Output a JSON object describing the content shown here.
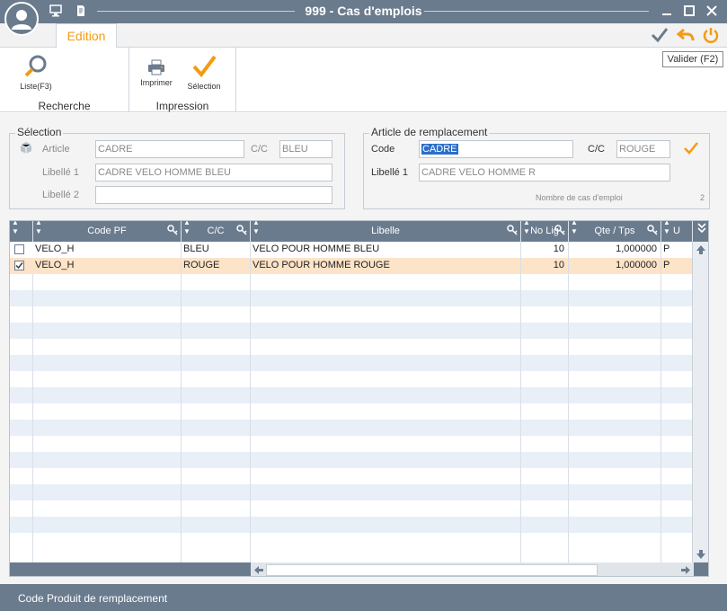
{
  "window": {
    "title": "999 - Cas d'emplois"
  },
  "header": {
    "tooltip": "Valider (F2)"
  },
  "ribbon": {
    "tab_label": "Edition",
    "groups": [
      {
        "label": "Recherche",
        "buttons": [
          {
            "label": "Liste(F3)",
            "icon": "magnifier-icon"
          }
        ]
      },
      {
        "label": "Impression",
        "buttons": [
          {
            "label": "Imprimer",
            "icon": "printer-icon"
          },
          {
            "label": "Sélection",
            "icon": "checkmark-icon"
          }
        ]
      }
    ]
  },
  "selection": {
    "title": "Sélection",
    "article_label": "Article",
    "article_value": "CADRE",
    "cc_label": "C/C",
    "cc_value": "BLEU",
    "libelle1_label": "Libellé 1",
    "libelle1_value": "CADRE VELO HOMME BLEU",
    "libelle2_label": "Libellé 2",
    "libelle2_value": ""
  },
  "replacement": {
    "title": "Article de remplacement",
    "code_label": "Code",
    "code_value": "CADRE",
    "cc_label": "C/C",
    "cc_value": "ROUGE",
    "libelle1_label": "Libellé 1",
    "libelle1_value": "CADRE VELO HOMME R",
    "count_label": "Nombre de cas d'emploi",
    "count_value": "2"
  },
  "grid": {
    "columns": [
      "Code PF",
      "C/C",
      "Libelle",
      "No Lig",
      "Qte / Tps",
      "U"
    ],
    "rows": [
      {
        "checked": false,
        "code_pf": "VELO_H",
        "cc": "BLEU",
        "libelle": "VELO POUR HOMME BLEU",
        "no_lig": "10",
        "qte": "1,000000",
        "u": "P"
      },
      {
        "checked": true,
        "code_pf": "VELO_H",
        "cc": "ROUGE",
        "libelle": "VELO POUR HOMME ROUGE",
        "no_lig": "10",
        "qte": "1,000000",
        "u": "P"
      }
    ]
  },
  "status": {
    "text": "Code Produit de remplacement"
  },
  "colors": {
    "titlebar": "#6a7b8e",
    "accent": "#f39c12",
    "selected_row": "#fde3c8",
    "stripe": "#e8eff7"
  }
}
